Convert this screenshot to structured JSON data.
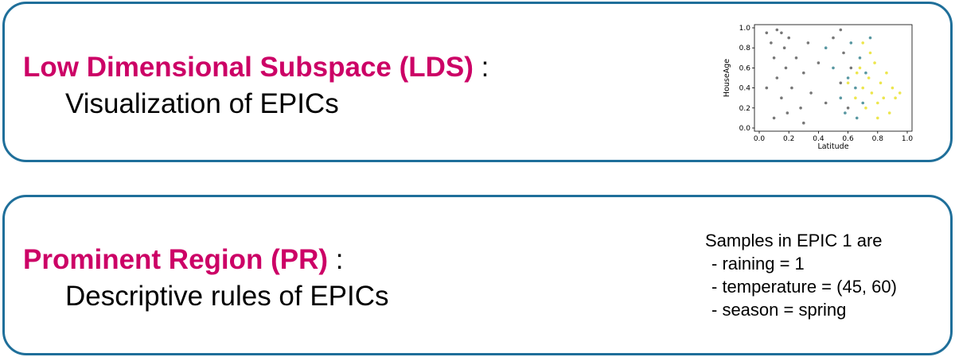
{
  "lds": {
    "name": "Low Dimensional Subspace (LDS)",
    "colon": ":",
    "subtitle": "Visualization of EPICs"
  },
  "pr": {
    "name": "Prominent Region (PR)",
    "colon": ":",
    "subtitle": "Descriptive rules of EPICs",
    "rules_title": "Samples in EPIC 1 are",
    "rules": [
      "- raining = 1",
      "- temperature = (45, 60)",
      "- season = spring"
    ]
  },
  "colors": {
    "border": "#1f6f9a",
    "accent": "#cc0066"
  },
  "chart_data": {
    "type": "scatter",
    "title": "",
    "xlabel": "Latitude",
    "ylabel": "HouseAge",
    "xlim": [
      0.0,
      1.0
    ],
    "ylim": [
      0.0,
      1.0
    ],
    "xticks": [
      "0.0",
      "0.2",
      "0.4",
      "0.6",
      "0.8",
      "1.0"
    ],
    "yticks": [
      "0.0",
      "0.2",
      "0.4",
      "0.6",
      "0.8",
      "1.0"
    ],
    "grid": false,
    "legend": "none",
    "series": [
      {
        "color": "#555555",
        "points": [
          [
            0.05,
            0.95
          ],
          [
            0.08,
            0.85
          ],
          [
            0.1,
            0.7
          ],
          [
            0.12,
            0.5
          ],
          [
            0.15,
            0.95
          ],
          [
            0.15,
            0.3
          ],
          [
            0.17,
            0.8
          ],
          [
            0.18,
            0.6
          ],
          [
            0.19,
            0.15
          ],
          [
            0.2,
            0.9
          ],
          [
            0.22,
            0.4
          ],
          [
            0.25,
            0.7
          ],
          [
            0.28,
            0.2
          ],
          [
            0.3,
            0.55
          ],
          [
            0.33,
            0.85
          ],
          [
            0.35,
            0.35
          ],
          [
            0.4,
            0.65
          ],
          [
            0.45,
            0.25
          ],
          [
            0.5,
            0.9
          ],
          [
            0.55,
            0.45
          ],
          [
            0.57,
            0.75
          ],
          [
            0.6,
            0.2
          ],
          [
            0.62,
            0.6
          ],
          [
            0.3,
            0.05
          ],
          [
            0.1,
            0.1
          ],
          [
            0.05,
            0.4
          ],
          [
            0.55,
            0.98
          ],
          [
            0.12,
            0.98
          ]
        ]
      },
      {
        "color": "#2e7d8a",
        "points": [
          [
            0.45,
            0.8
          ],
          [
            0.5,
            0.6
          ],
          [
            0.55,
            0.3
          ],
          [
            0.6,
            0.5
          ],
          [
            0.62,
            0.85
          ],
          [
            0.65,
            0.4
          ],
          [
            0.68,
            0.7
          ],
          [
            0.7,
            0.25
          ],
          [
            0.72,
            0.55
          ],
          [
            0.75,
            0.9
          ],
          [
            0.58,
            0.15
          ],
          [
            0.66,
            0.1
          ]
        ]
      },
      {
        "color": "#e8e020",
        "points": [
          [
            0.6,
            0.45
          ],
          [
            0.65,
            0.3
          ],
          [
            0.68,
            0.6
          ],
          [
            0.7,
            0.4
          ],
          [
            0.72,
            0.2
          ],
          [
            0.74,
            0.5
          ],
          [
            0.76,
            0.35
          ],
          [
            0.78,
            0.65
          ],
          [
            0.8,
            0.25
          ],
          [
            0.82,
            0.45
          ],
          [
            0.84,
            0.3
          ],
          [
            0.86,
            0.55
          ],
          [
            0.88,
            0.15
          ],
          [
            0.9,
            0.4
          ],
          [
            0.92,
            0.3
          ],
          [
            0.95,
            0.35
          ],
          [
            0.75,
            0.75
          ],
          [
            0.7,
            0.85
          ],
          [
            0.8,
            0.1
          ],
          [
            0.66,
            0.55
          ]
        ]
      }
    ]
  }
}
